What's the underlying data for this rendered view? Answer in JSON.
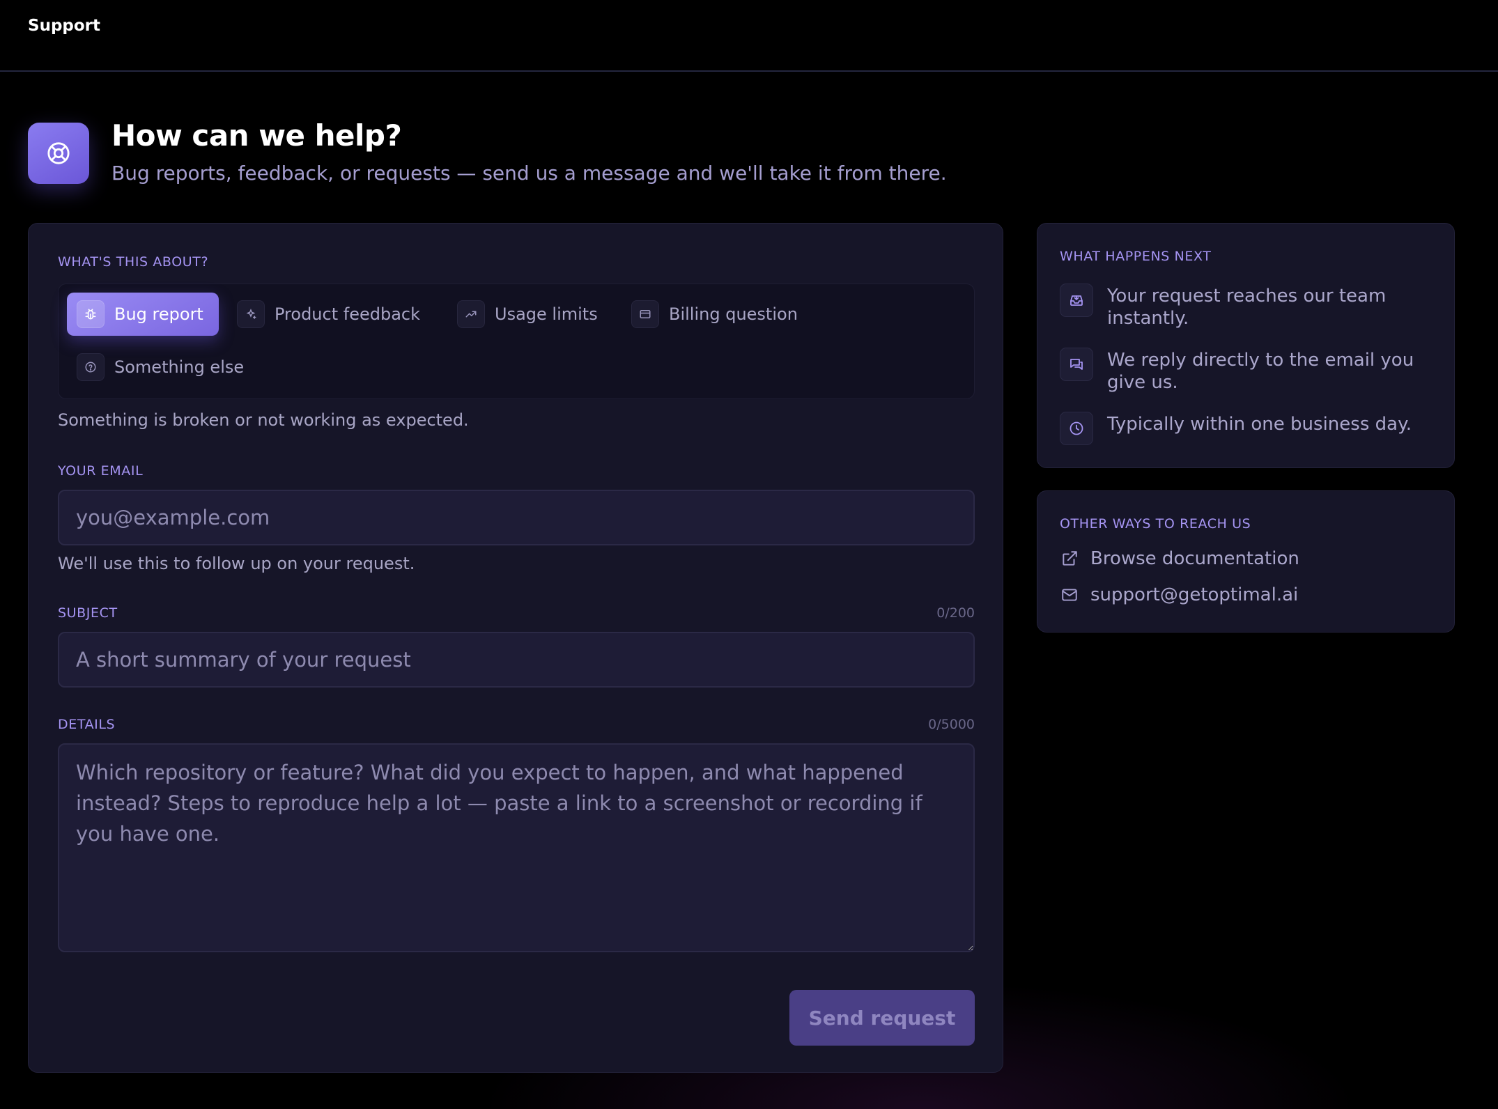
{
  "header": {
    "title": "Support"
  },
  "hero": {
    "icon": "lifebuoy-icon",
    "title": "How can we help?",
    "subtitle": "Bug reports, feedback, or requests — send us a message and we'll take it from there."
  },
  "form": {
    "topic_label": "WHAT'S THIS ABOUT?",
    "topics": [
      {
        "label": "Bug report",
        "icon": "bug-icon",
        "selected": true
      },
      {
        "label": "Product feedback",
        "icon": "sparkles-icon",
        "selected": false
      },
      {
        "label": "Usage limits",
        "icon": "trending-up-icon",
        "selected": false
      },
      {
        "label": "Billing question",
        "icon": "credit-card-icon",
        "selected": false
      },
      {
        "label": "Something else",
        "icon": "help-circle-icon",
        "selected": false
      }
    ],
    "topic_description": "Something is broken or not working as expected.",
    "email": {
      "label": "YOUR EMAIL",
      "placeholder": "you@example.com",
      "value": "",
      "hint": "We'll use this to follow up on your request."
    },
    "subject": {
      "label": "SUBJECT",
      "placeholder": "A short summary of your request",
      "value": "",
      "counter": "0/200"
    },
    "details": {
      "label": "DETAILS",
      "placeholder": "Which repository or feature? What did you expect to happen, and what happened instead? Steps to reproduce help a lot — paste a link to a screenshot or recording if you have one.",
      "value": "",
      "counter": "0/5000"
    },
    "submit_label": "Send request"
  },
  "next_steps": {
    "title": "WHAT HAPPENS NEXT",
    "items": [
      {
        "icon": "inbox-icon",
        "text": "Your request reaches our team instantly."
      },
      {
        "icon": "message-icon",
        "text": "We reply directly to the email you give us."
      },
      {
        "icon": "clock-icon",
        "text": "Typically within one business day."
      }
    ]
  },
  "other_ways": {
    "title": "OTHER WAYS TO REACH US",
    "items": [
      {
        "icon": "external-link-icon",
        "text": "Browse documentation"
      },
      {
        "icon": "mail-icon",
        "text": "support@getoptimal.ai"
      }
    ]
  },
  "colors": {
    "accent": "#8a7cf0",
    "background": "#000000",
    "card": "#161528",
    "label": "#a594f2"
  }
}
